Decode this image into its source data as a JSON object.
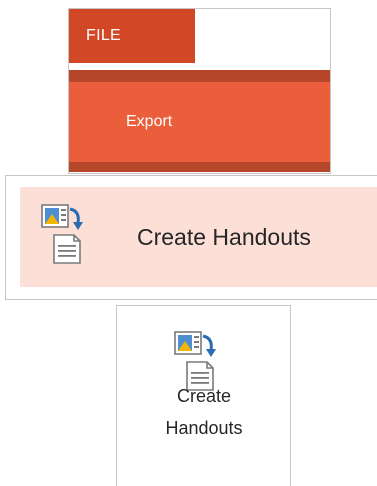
{
  "file_menu": {
    "tab_label": "FILE",
    "export_label": "Export"
  },
  "wide_command": {
    "label": "Create Handouts",
    "icon": "create-handouts-icon"
  },
  "tall_command": {
    "label": "Create\nHandouts",
    "icon": "create-handouts-icon"
  },
  "colors": {
    "file_tab": "#d24726",
    "export_selected": "#eb5e3c",
    "highlight": "#fcdfd7"
  }
}
